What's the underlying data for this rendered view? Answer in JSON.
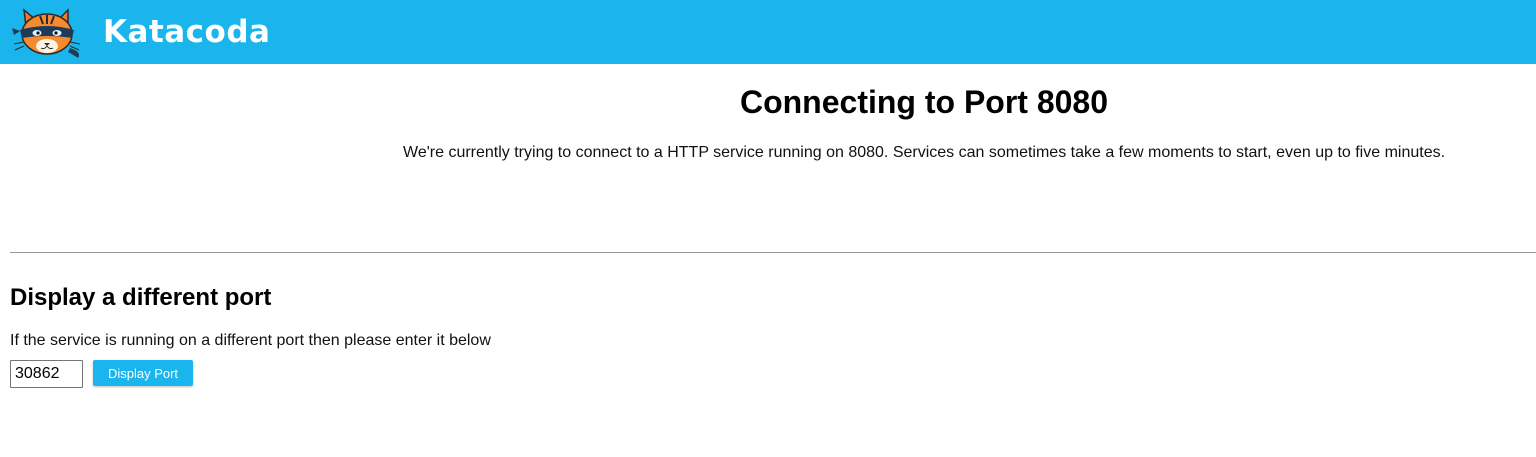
{
  "header": {
    "logo_text": "Katacoda",
    "logo_icon": "katacoda-cat-mascot-icon",
    "background_color": "#1ab5ec"
  },
  "main": {
    "title": "Connecting to Port 8080",
    "description": "We're currently trying to connect to a HTTP service running on 8080. Services can sometimes take a few moments to start, even up to five minutes."
  },
  "alternate_port": {
    "title": "Display a different port",
    "description": "If the service is running on a different port then please enter it below",
    "port_value": "30862",
    "button_label": "Display Port",
    "button_color": "#1ab5ec"
  }
}
